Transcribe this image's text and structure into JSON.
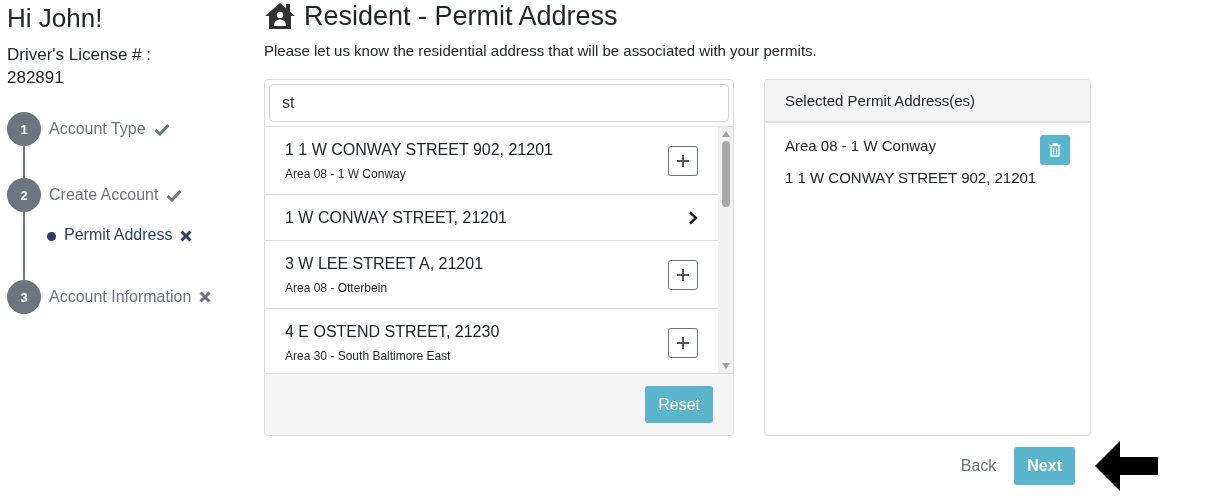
{
  "greeting": "Hi John!",
  "license": {
    "label": "Driver's License # :",
    "value": "282891"
  },
  "steps": [
    {
      "number": "1",
      "label": "Account Type",
      "completed": true
    },
    {
      "number": "2",
      "label": "Create Account",
      "completed": true,
      "children": [
        {
          "label": "Permit Address",
          "completed": false,
          "selected": true
        }
      ]
    },
    {
      "number": "3",
      "label": "Account Information",
      "completed": false
    }
  ],
  "title": "Resident - Permit Address",
  "intro": "Please let us know the residential address that will be associated with your permits.",
  "search": {
    "value": "st"
  },
  "results": [
    {
      "kind": "address",
      "address": "1 1 W CONWAY STREET 902, 21201",
      "area": "Area 08 - 1 W Conway"
    },
    {
      "kind": "group",
      "address": "1 W CONWAY STREET, 21201"
    },
    {
      "kind": "address",
      "address": "3 W LEE STREET A, 21201",
      "area": "Area 08 - Otterbein"
    },
    {
      "kind": "address",
      "address": "4 E OSTEND STREET, 21230",
      "area": "Area 30 - South Baltimore East"
    }
  ],
  "reset_button": "Reset",
  "selected_panel": {
    "heading": "Selected Permit Address(es)",
    "items": [
      {
        "area": "Area 08 - 1 W Conway",
        "address": "1 1 W CONWAY STREET 902, 21201"
      }
    ]
  },
  "back_button": "Back",
  "next_button": "Next"
}
